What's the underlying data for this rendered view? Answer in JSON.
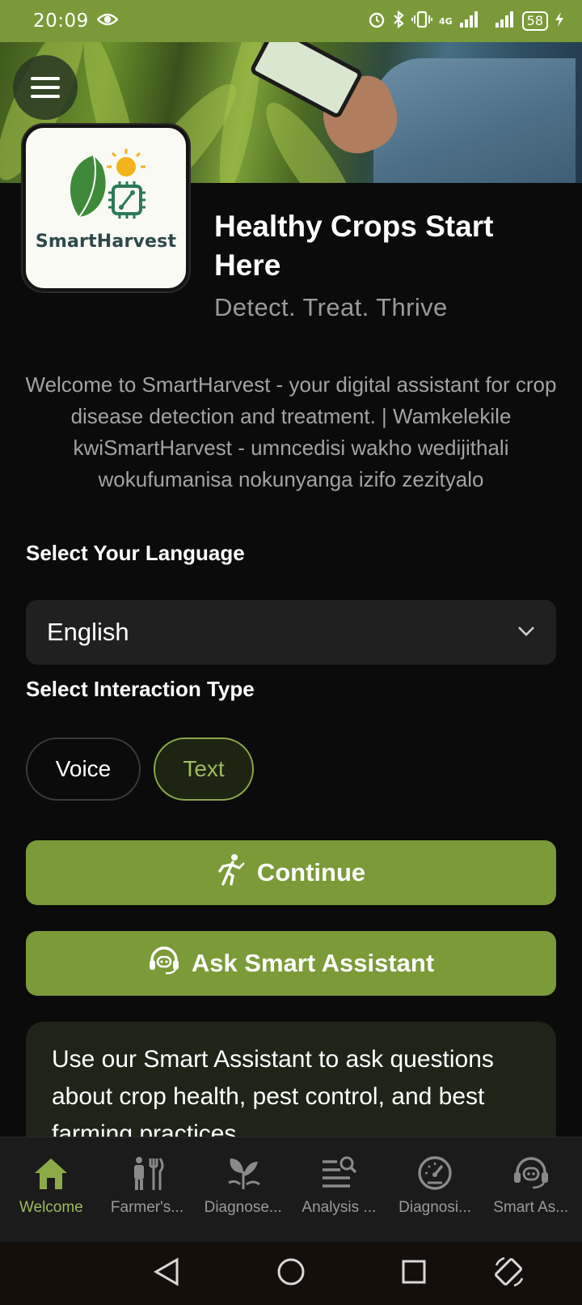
{
  "status_bar": {
    "time": "20:09",
    "network": "4G",
    "battery": "58"
  },
  "hero": {
    "menu_icon": "hamburger-icon"
  },
  "logo": {
    "text": "SmartHarvest"
  },
  "header": {
    "title": "Healthy Crops Start Here",
    "subtitle": "Detect. Treat. Thrive"
  },
  "welcome_text": "Welcome to SmartHarvest - your digital assistant for crop disease detection and treatment. | Wamkelekile kwiSmartHarvest - umncedisi wakho wedijithali wokufumanisa nokunyanga izifo zezityalo",
  "language": {
    "label": "Select Your Language",
    "selected": "English"
  },
  "interaction": {
    "label": "Select Interaction Type",
    "options": [
      "Voice",
      "Text"
    ],
    "selected": "Text"
  },
  "buttons": {
    "continue": "Continue",
    "ask_assistant": "Ask Smart Assistant"
  },
  "info_card": {
    "text": "Use our Smart Assistant to ask questions about crop health, pest control, and best farming practices."
  },
  "bottom_nav": {
    "items": [
      {
        "label": "Welcome",
        "icon": "home-icon",
        "active": true
      },
      {
        "label": "Farmer's...",
        "icon": "farmer-tools-icon",
        "active": false
      },
      {
        "label": "Diagnose...",
        "icon": "plant-diagnose-icon",
        "active": false
      },
      {
        "label": "Analysis ...",
        "icon": "analysis-icon",
        "active": false
      },
      {
        "label": "Diagnosi...",
        "icon": "gauge-icon",
        "active": false
      },
      {
        "label": "Smart As...",
        "icon": "headset-icon",
        "active": false
      }
    ]
  },
  "colors": {
    "accent": "#7b9a38",
    "accent_text": "#9fbc5e",
    "background": "#0b0b0b",
    "status_bar": "#7a9a3a"
  }
}
